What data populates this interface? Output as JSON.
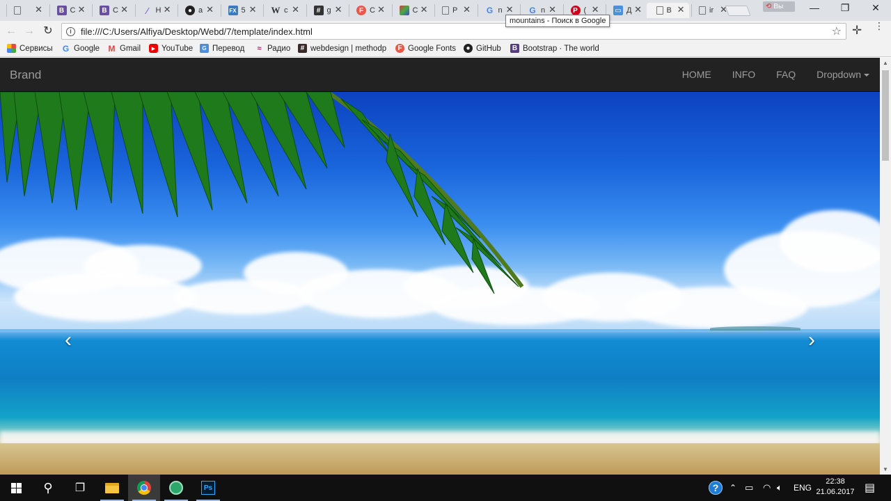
{
  "browser": {
    "tabs": [
      {
        "icon": "blank-page-icon",
        "title": "",
        "active": false
      },
      {
        "icon": "vk-icon",
        "title": "C",
        "active": false
      },
      {
        "icon": "vk-icon",
        "title": "C",
        "active": false
      },
      {
        "icon": "slash-icon",
        "title": "H",
        "active": false
      },
      {
        "icon": "github-icon",
        "title": "a",
        "active": false
      },
      {
        "icon": "fx-icon",
        "title": "5",
        "active": false
      },
      {
        "icon": "wikipedia-icon",
        "title": "c",
        "active": false
      },
      {
        "icon": "hash-icon",
        "title": "g",
        "active": false
      },
      {
        "icon": "google-fonts-icon",
        "title": "C",
        "active": false
      },
      {
        "icon": "image-icon",
        "title": "C",
        "active": false
      },
      {
        "icon": "blank-page-icon",
        "title": "P",
        "active": false
      },
      {
        "icon": "google-icon",
        "title": "n",
        "active": false
      },
      {
        "icon": "google-icon",
        "title": "n",
        "active": false
      },
      {
        "icon": "pinterest-icon",
        "title": "(",
        "active": false
      },
      {
        "icon": "doc-icon",
        "title": "Д",
        "active": false
      },
      {
        "icon": "blank-page-icon",
        "title": "B",
        "active": true
      },
      {
        "icon": "blank-page-icon",
        "title": "ir",
        "active": false
      }
    ],
    "tab_close_glyph": "✕",
    "profile_label": "Вы",
    "window_controls": {
      "minimize": "—",
      "maximize": "❐",
      "close": "✕"
    },
    "tooltip": "mountains - Поиск в Google",
    "address_url": "file:///C:/Users/Alfiya/Desktop/Webd/7/template/index.html",
    "nav_glyphs": {
      "back": "←",
      "forward": "→",
      "reload": "↻",
      "star": "☆",
      "extension": "✛",
      "menu": "⋮",
      "info": "i"
    }
  },
  "bookmarks": [
    {
      "icon": "apps-icon",
      "glyph": "",
      "label": "Сервисы"
    },
    {
      "icon": "google-icon",
      "glyph": "G",
      "label": "Google"
    },
    {
      "icon": "gmail-icon",
      "glyph": "M",
      "label": "Gmail"
    },
    {
      "icon": "youtube-icon",
      "glyph": "▶",
      "label": "YouTube"
    },
    {
      "icon": "translate-icon",
      "glyph": "G",
      "label": "Перевод"
    },
    {
      "icon": "radio-icon",
      "glyph": "≈",
      "label": "Радио"
    },
    {
      "icon": "hash-icon",
      "glyph": "#",
      "label": "webdesign | methodp"
    },
    {
      "icon": "google-fonts-icon",
      "glyph": "F",
      "label": "Google Fonts"
    },
    {
      "icon": "github-icon",
      "glyph": "●",
      "label": "GitHub"
    },
    {
      "icon": "bootstrap-icon",
      "glyph": "B",
      "label": "Bootstrap · The world"
    }
  ],
  "page": {
    "brand": "Brand",
    "nav": [
      "HOME",
      "INFO",
      "FAQ",
      "Dropdown"
    ],
    "carousel": {
      "prev_glyph": "‹",
      "next_glyph": "›"
    }
  },
  "taskbar": {
    "apps": [
      {
        "name": "start-button",
        "open": false
      },
      {
        "name": "search-button",
        "open": false
      },
      {
        "name": "task-view-button",
        "open": false
      },
      {
        "name": "file-explorer",
        "open": true
      },
      {
        "name": "chrome",
        "open": true
      },
      {
        "name": "globe-app",
        "open": true
      },
      {
        "name": "photoshop",
        "open": true
      }
    ],
    "photoshop_label": "Ps",
    "language": "ENG",
    "time": "22:38",
    "date": "21.06.2017"
  }
}
